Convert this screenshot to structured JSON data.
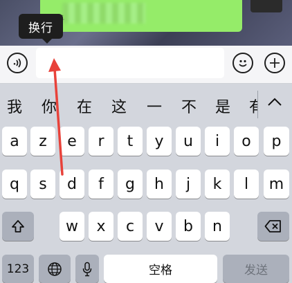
{
  "chat": {
    "bubble_text": "日千"
  },
  "input_bar": {
    "tooltip": "换行"
  },
  "candidates": [
    "我",
    "你",
    "在",
    "这",
    "一",
    "不",
    "是",
    "有"
  ],
  "keyboard": {
    "row1": [
      "a",
      "z",
      "e",
      "r",
      "t",
      "y",
      "u",
      "i",
      "o",
      "p"
    ],
    "row2": [
      "q",
      "s",
      "d",
      "f",
      "g",
      "h",
      "j",
      "k",
      "l",
      "m"
    ],
    "row3": [
      "w",
      "x",
      "c",
      "v",
      "b",
      "n"
    ],
    "numbers_label": "123",
    "space_label": "空格",
    "send_label": "发送"
  },
  "icons": {
    "voice": "voice-icon",
    "emoji": "emoji-icon",
    "add": "plus-icon",
    "expand": "chevron-up-icon",
    "shift": "shift-icon",
    "delete": "backspace-icon",
    "globe": "globe-icon",
    "mic": "microphone-icon"
  },
  "colors": {
    "bubble": "#95ec69",
    "annotation_arrow": "#e8423a",
    "tooltip_bg": "#1e1e1e"
  }
}
